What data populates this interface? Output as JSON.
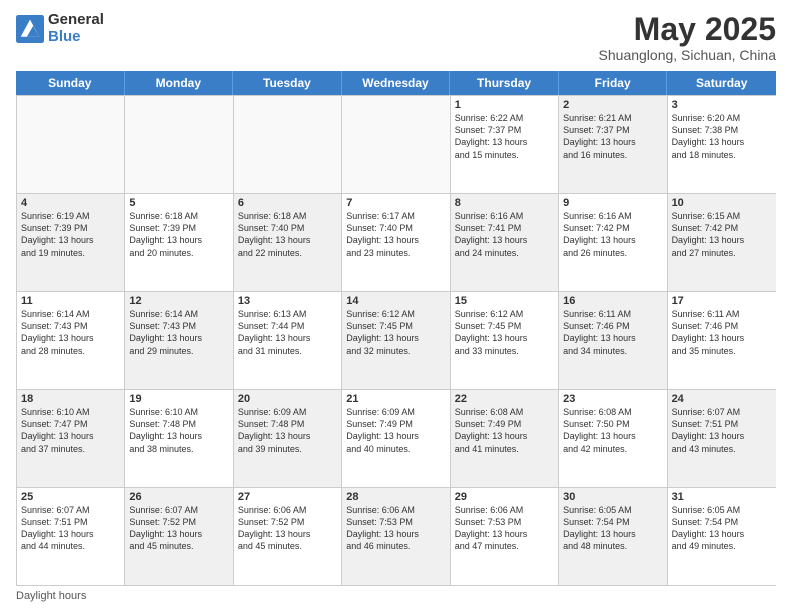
{
  "header": {
    "logo_general": "General",
    "logo_blue": "Blue",
    "month_title": "May 2025",
    "subtitle": "Shuanglong, Sichuan, China"
  },
  "days_of_week": [
    "Sunday",
    "Monday",
    "Tuesday",
    "Wednesday",
    "Thursday",
    "Friday",
    "Saturday"
  ],
  "weeks": [
    [
      {
        "day": "",
        "info": "",
        "shaded": false,
        "empty": true
      },
      {
        "day": "",
        "info": "",
        "shaded": false,
        "empty": true
      },
      {
        "day": "",
        "info": "",
        "shaded": false,
        "empty": true
      },
      {
        "day": "",
        "info": "",
        "shaded": false,
        "empty": true
      },
      {
        "day": "1",
        "info": "Sunrise: 6:22 AM\nSunset: 7:37 PM\nDaylight: 13 hours\nand 15 minutes.",
        "shaded": false,
        "empty": false
      },
      {
        "day": "2",
        "info": "Sunrise: 6:21 AM\nSunset: 7:37 PM\nDaylight: 13 hours\nand 16 minutes.",
        "shaded": true,
        "empty": false
      },
      {
        "day": "3",
        "info": "Sunrise: 6:20 AM\nSunset: 7:38 PM\nDaylight: 13 hours\nand 18 minutes.",
        "shaded": false,
        "empty": false
      }
    ],
    [
      {
        "day": "4",
        "info": "Sunrise: 6:19 AM\nSunset: 7:39 PM\nDaylight: 13 hours\nand 19 minutes.",
        "shaded": true,
        "empty": false
      },
      {
        "day": "5",
        "info": "Sunrise: 6:18 AM\nSunset: 7:39 PM\nDaylight: 13 hours\nand 20 minutes.",
        "shaded": false,
        "empty": false
      },
      {
        "day": "6",
        "info": "Sunrise: 6:18 AM\nSunset: 7:40 PM\nDaylight: 13 hours\nand 22 minutes.",
        "shaded": true,
        "empty": false
      },
      {
        "day": "7",
        "info": "Sunrise: 6:17 AM\nSunset: 7:40 PM\nDaylight: 13 hours\nand 23 minutes.",
        "shaded": false,
        "empty": false
      },
      {
        "day": "8",
        "info": "Sunrise: 6:16 AM\nSunset: 7:41 PM\nDaylight: 13 hours\nand 24 minutes.",
        "shaded": true,
        "empty": false
      },
      {
        "day": "9",
        "info": "Sunrise: 6:16 AM\nSunset: 7:42 PM\nDaylight: 13 hours\nand 26 minutes.",
        "shaded": false,
        "empty": false
      },
      {
        "day": "10",
        "info": "Sunrise: 6:15 AM\nSunset: 7:42 PM\nDaylight: 13 hours\nand 27 minutes.",
        "shaded": true,
        "empty": false
      }
    ],
    [
      {
        "day": "11",
        "info": "Sunrise: 6:14 AM\nSunset: 7:43 PM\nDaylight: 13 hours\nand 28 minutes.",
        "shaded": false,
        "empty": false
      },
      {
        "day": "12",
        "info": "Sunrise: 6:14 AM\nSunset: 7:43 PM\nDaylight: 13 hours\nand 29 minutes.",
        "shaded": true,
        "empty": false
      },
      {
        "day": "13",
        "info": "Sunrise: 6:13 AM\nSunset: 7:44 PM\nDaylight: 13 hours\nand 31 minutes.",
        "shaded": false,
        "empty": false
      },
      {
        "day": "14",
        "info": "Sunrise: 6:12 AM\nSunset: 7:45 PM\nDaylight: 13 hours\nand 32 minutes.",
        "shaded": true,
        "empty": false
      },
      {
        "day": "15",
        "info": "Sunrise: 6:12 AM\nSunset: 7:45 PM\nDaylight: 13 hours\nand 33 minutes.",
        "shaded": false,
        "empty": false
      },
      {
        "day": "16",
        "info": "Sunrise: 6:11 AM\nSunset: 7:46 PM\nDaylight: 13 hours\nand 34 minutes.",
        "shaded": true,
        "empty": false
      },
      {
        "day": "17",
        "info": "Sunrise: 6:11 AM\nSunset: 7:46 PM\nDaylight: 13 hours\nand 35 minutes.",
        "shaded": false,
        "empty": false
      }
    ],
    [
      {
        "day": "18",
        "info": "Sunrise: 6:10 AM\nSunset: 7:47 PM\nDaylight: 13 hours\nand 37 minutes.",
        "shaded": true,
        "empty": false
      },
      {
        "day": "19",
        "info": "Sunrise: 6:10 AM\nSunset: 7:48 PM\nDaylight: 13 hours\nand 38 minutes.",
        "shaded": false,
        "empty": false
      },
      {
        "day": "20",
        "info": "Sunrise: 6:09 AM\nSunset: 7:48 PM\nDaylight: 13 hours\nand 39 minutes.",
        "shaded": true,
        "empty": false
      },
      {
        "day": "21",
        "info": "Sunrise: 6:09 AM\nSunset: 7:49 PM\nDaylight: 13 hours\nand 40 minutes.",
        "shaded": false,
        "empty": false
      },
      {
        "day": "22",
        "info": "Sunrise: 6:08 AM\nSunset: 7:49 PM\nDaylight: 13 hours\nand 41 minutes.",
        "shaded": true,
        "empty": false
      },
      {
        "day": "23",
        "info": "Sunrise: 6:08 AM\nSunset: 7:50 PM\nDaylight: 13 hours\nand 42 minutes.",
        "shaded": false,
        "empty": false
      },
      {
        "day": "24",
        "info": "Sunrise: 6:07 AM\nSunset: 7:51 PM\nDaylight: 13 hours\nand 43 minutes.",
        "shaded": true,
        "empty": false
      }
    ],
    [
      {
        "day": "25",
        "info": "Sunrise: 6:07 AM\nSunset: 7:51 PM\nDaylight: 13 hours\nand 44 minutes.",
        "shaded": false,
        "empty": false
      },
      {
        "day": "26",
        "info": "Sunrise: 6:07 AM\nSunset: 7:52 PM\nDaylight: 13 hours\nand 45 minutes.",
        "shaded": true,
        "empty": false
      },
      {
        "day": "27",
        "info": "Sunrise: 6:06 AM\nSunset: 7:52 PM\nDaylight: 13 hours\nand 45 minutes.",
        "shaded": false,
        "empty": false
      },
      {
        "day": "28",
        "info": "Sunrise: 6:06 AM\nSunset: 7:53 PM\nDaylight: 13 hours\nand 46 minutes.",
        "shaded": true,
        "empty": false
      },
      {
        "day": "29",
        "info": "Sunrise: 6:06 AM\nSunset: 7:53 PM\nDaylight: 13 hours\nand 47 minutes.",
        "shaded": false,
        "empty": false
      },
      {
        "day": "30",
        "info": "Sunrise: 6:05 AM\nSunset: 7:54 PM\nDaylight: 13 hours\nand 48 minutes.",
        "shaded": true,
        "empty": false
      },
      {
        "day": "31",
        "info": "Sunrise: 6:05 AM\nSunset: 7:54 PM\nDaylight: 13 hours\nand 49 minutes.",
        "shaded": false,
        "empty": false
      }
    ]
  ],
  "footer": {
    "note": "Daylight hours"
  }
}
